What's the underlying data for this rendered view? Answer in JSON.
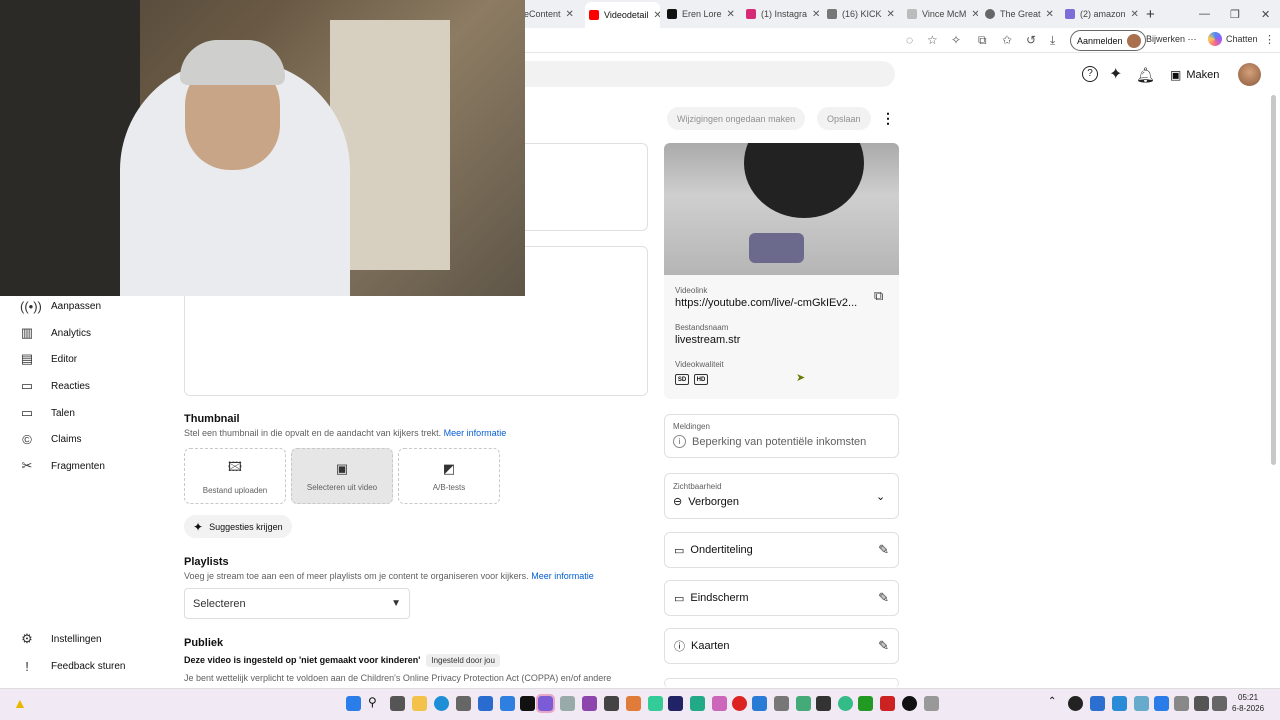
{
  "browser": {
    "tabs": [
      {
        "label": "eContent",
        "color": "#888"
      },
      {
        "label": "Videodetail",
        "color": "#ff0000"
      },
      {
        "label": "Eren Lore",
        "color": "#111"
      },
      {
        "label": "(1) Instagra",
        "color": "#d62976"
      },
      {
        "label": "(16) KICK",
        "color": "#777"
      },
      {
        "label": "Vince McM",
        "color": "#999"
      },
      {
        "label": "The Great",
        "color": "#666"
      },
      {
        "label": "(2) amazon",
        "color": "#7b6cd8"
      }
    ],
    "aanmelden": "Aanmelden",
    "bijwerken": "Bijwerken",
    "chatten": "Chatten"
  },
  "header": {
    "create_label": "Maken"
  },
  "actions": {
    "undo": "Wijzigingen ongedaan maken",
    "save": "Opslaan"
  },
  "nav": {
    "items": [
      {
        "label": "Aanpassen",
        "icon": "broadcast-icon"
      },
      {
        "label": "Analytics",
        "icon": "analytics-icon"
      },
      {
        "label": "Editor",
        "icon": "editor-icon"
      },
      {
        "label": "Reacties",
        "icon": "comments-icon"
      },
      {
        "label": "Talen",
        "icon": "subtitles-icon"
      },
      {
        "label": "Claims",
        "icon": "claims-icon"
      },
      {
        "label": "Fragmenten",
        "icon": "scissors-icon"
      }
    ],
    "settings": "Instellingen",
    "feedback": "Feedback sturen"
  },
  "thumbnail": {
    "title": "Thumbnail",
    "desc": "Stel een thumbnail in die opvalt en de aandacht van kijkers trekt.",
    "link": "Meer informatie",
    "options": [
      "Bestand uploaden",
      "Selecteren uit video",
      "A/B-tests"
    ],
    "suggest": "Suggesties krijgen"
  },
  "playlists": {
    "title": "Playlists",
    "desc": "Voeg je stream toe aan een of meer playlists om je content te organiseren voor kijkers.",
    "link": "Meer informatie",
    "select": "Selecteren"
  },
  "audience": {
    "title": "Publiek",
    "set_text": "Deze video is ingesteld op 'niet gemaakt voor kinderen'",
    "pill": "Ingesteld door jou",
    "legal": "Je bent wettelijk verplicht te voldoen aan de Children's Online Privacy Protection Act (COPPA) en/of andere"
  },
  "video": {
    "link_label": "Videolink",
    "link": "https://youtube.com/live/-cmGkIEv2...",
    "filename_label": "Bestandsnaam",
    "filename": "livestream.str",
    "quality_label": "Videokwaliteit",
    "quality": [
      "SD",
      "HD"
    ]
  },
  "notices": {
    "label": "Meldingen",
    "text": "Beperking van potentiële inkomsten"
  },
  "visibility": {
    "label": "Zichtbaarheid",
    "value": "Verborgen"
  },
  "rows": {
    "subtitles": "Ondertiteling",
    "endscreen": "Eindscherm",
    "cards": "Kaarten"
  },
  "clock": {
    "time": "05:21",
    "date": "6-8-2026"
  }
}
